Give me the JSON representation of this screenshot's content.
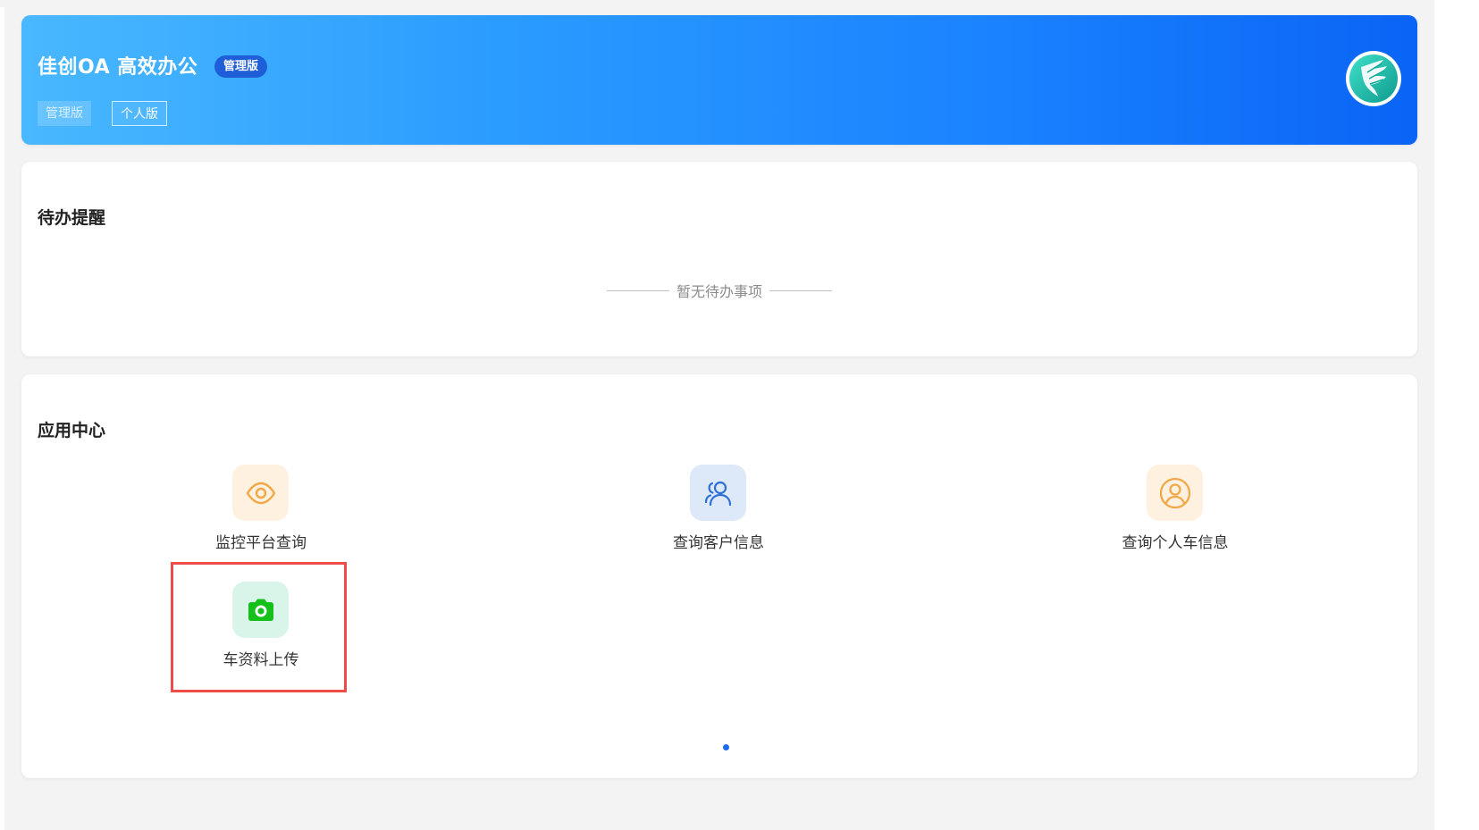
{
  "header": {
    "title": "佳创OA 高效办公",
    "badge": "管理版",
    "versions": {
      "admin_label": "管理版",
      "personal_label": "个人版"
    },
    "avatar_icon": "feather-logo-icon"
  },
  "todo": {
    "title": "待办提醒",
    "empty_text": "暂无待办事项"
  },
  "apps": {
    "title": "应用中心",
    "items": [
      {
        "label": "监控平台查询",
        "icon": "eye-icon",
        "color": "#f0a848"
      },
      {
        "label": "查询客户信息",
        "icon": "users-icon",
        "color": "#2f6fd6"
      },
      {
        "label": "查询个人车信息",
        "icon": "user-circle-icon",
        "color": "#f0a848"
      },
      {
        "label": "车资料上传",
        "icon": "camera-icon",
        "color": "#16c01a"
      }
    ],
    "page_count": 1,
    "current_page": 1
  },
  "colors": {
    "banner_start": "#49b8ff",
    "banner_end": "#0a64f5",
    "badge": "#1e5ed8",
    "highlight": "#ee4b4b",
    "pager_dot": "#1d6cf0"
  }
}
